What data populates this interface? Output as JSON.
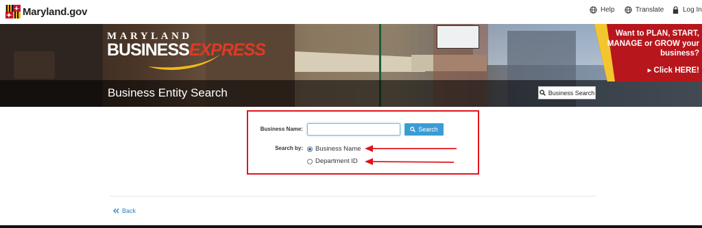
{
  "header": {
    "logo_text": "Maryland.gov",
    "help": "Help",
    "translate": "Translate",
    "login": "Log In"
  },
  "banner": {
    "brand_top": "MARYLAND",
    "brand_business": "BUSINESS",
    "brand_express": "EXPRESS",
    "page_title": "Business Entity Search",
    "search_button": "Business Search",
    "promo_text": "Want to PLAN, START, MANAGE or GROW your business?",
    "promo_cta": "▸ Click HERE!"
  },
  "form": {
    "name_label": "Business Name:",
    "name_value": "",
    "search_button": "Search",
    "search_by_label": "Search by:",
    "options": [
      {
        "label": "Business Name",
        "selected": true
      },
      {
        "label": "Department ID",
        "selected": false
      }
    ]
  },
  "footer": {
    "back": "Back"
  },
  "colors": {
    "accent": "#3b9cd4",
    "annotation": "#e3131b",
    "promo": "#b7161d"
  }
}
